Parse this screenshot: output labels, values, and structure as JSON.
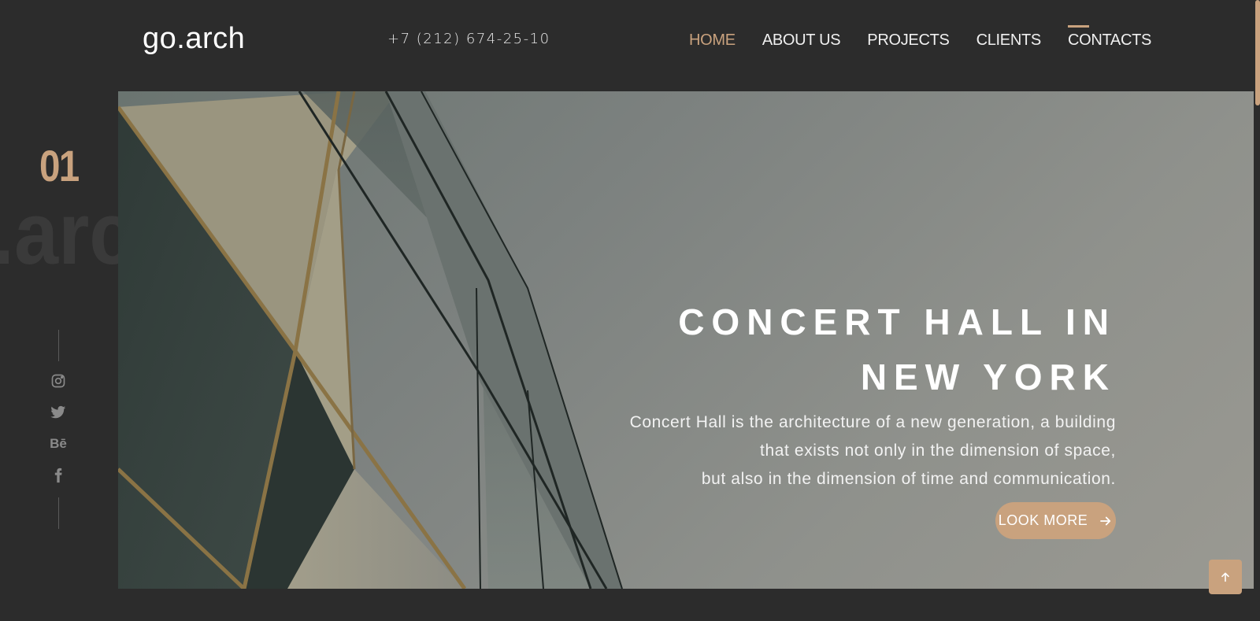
{
  "header": {
    "logo": "go.arch",
    "phone": "+7 (212) 674-25-10",
    "nav": [
      {
        "label": "HOME",
        "active": true
      },
      {
        "label": "ABOUT US",
        "active": false
      },
      {
        "label": "PROJECTS",
        "active": false
      },
      {
        "label": "CLIENTS",
        "active": false
      },
      {
        "label": "CONTACTS",
        "active": false
      }
    ]
  },
  "sidebar": {
    "slide_number": "01",
    "ghost_text": ".arch",
    "social_icons": [
      "instagram-icon",
      "twitter-icon",
      "behance-icon",
      "facebook-icon"
    ],
    "behance_label": "Bē"
  },
  "hero": {
    "title_line1": "CONCERT HALL IN",
    "title_line2": "NEW YORK",
    "desc_line1": "Concert Hall is the architecture of a new generation, a building",
    "desc_line2": "that exists not only in the dimension of space,",
    "desc_line3": "but also in the dimension of time and communication.",
    "button_label": "LOOK MORE",
    "button_icon": "arrow-right-icon"
  },
  "back_to_top_icon": "arrow-up-icon",
  "colors": {
    "background": "#2c2c2c",
    "accent": "#c9a27e",
    "text": "#ffffff",
    "muted": "#8a8a8a"
  }
}
